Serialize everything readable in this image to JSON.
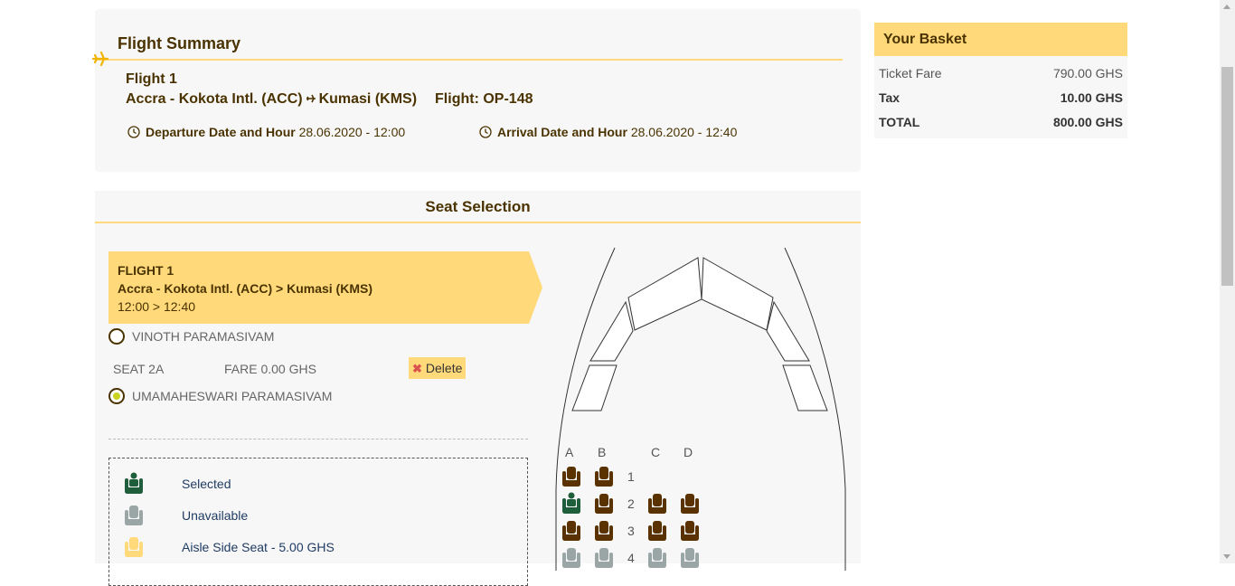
{
  "summary": {
    "title": "Flight Summary",
    "flight_label": "Flight 1",
    "origin": "Accra - Kokota Intl. (ACC)",
    "destination": "Kumasi (KMS)",
    "flight_no": "Flight: OP-148",
    "departure_label": "Departure Date and Hour",
    "departure_value": "28.06.2020 - 12:00",
    "arrival_label": "Arrival Date and Hour",
    "arrival_value": "28.06.2020 - 12:40"
  },
  "basket": {
    "title": "Your Basket",
    "rows": [
      {
        "label": "Ticket Fare",
        "value": "790.00 GHS"
      },
      {
        "label": "Tax",
        "value": "10.00 GHS"
      },
      {
        "label": "TOTAL",
        "value": "800.00 GHS"
      }
    ]
  },
  "seat_selection": {
    "title": "Seat Selection",
    "flight_card": {
      "line1": "FLIGHT 1",
      "line2": "Accra - Kokota Intl. (ACC) > Kumasi (KMS)",
      "line3": "12:00 > 12:40"
    },
    "passengers": [
      {
        "name": "VINOTH PARAMASIVAM",
        "selected": false
      },
      {
        "name": "UMAMAHESWARI PARAMASIVAM",
        "selected": true
      }
    ],
    "assigned_seat": "SEAT 2A",
    "fare": "FARE 0.00 GHS",
    "delete_label": "Delete",
    "legend": [
      {
        "label": "Selected",
        "icon": "seat-selected-icon",
        "color": "#1e5e3a"
      },
      {
        "label": "Unavailable",
        "icon": "seat-unavailable-icon",
        "color": "#9aa5a5"
      },
      {
        "label": "Aisle Side Seat - 5.00 GHS",
        "icon": "seat-aisle-icon",
        "color": "#ffd97a"
      }
    ],
    "columns": [
      "A",
      "B",
      "C",
      "D"
    ],
    "rows": [
      "1",
      "2",
      "3",
      "4"
    ]
  },
  "colors": {
    "accent": "#ffd97a",
    "brown": "#4a3300",
    "seat_available": "#5a3200",
    "seat_selected": "#1e5e3a",
    "seat_unavailable": "#9aa5a5"
  }
}
